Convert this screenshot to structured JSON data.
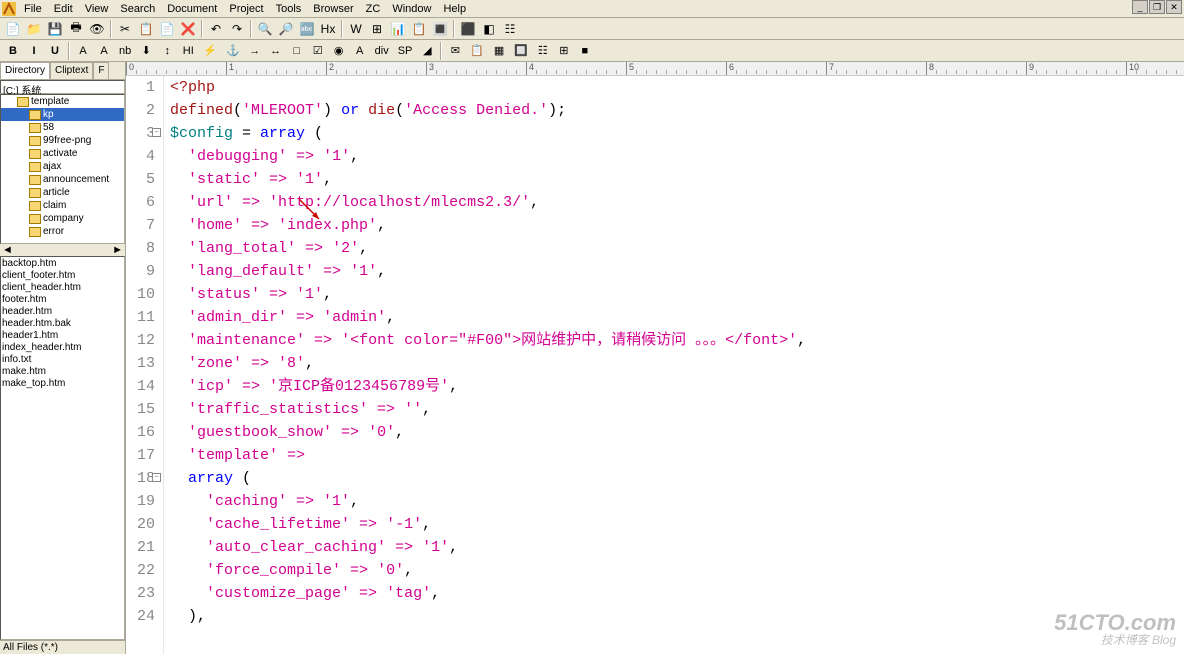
{
  "menu": [
    "File",
    "Edit",
    "View",
    "Search",
    "Document",
    "Project",
    "Tools",
    "Browser",
    "ZC",
    "Window",
    "Help"
  ],
  "winbtn": {
    "min": "_",
    "restore": "❐",
    "close": "✕"
  },
  "toolbar1": [
    "📄",
    "📁",
    "💾",
    "🖶",
    "👁",
    "|",
    "✂",
    "📋",
    "📄",
    "❌",
    "|",
    "↶",
    "↷",
    "|",
    "🔍",
    "🔎",
    "🔤",
    "Hx",
    "|",
    "W",
    "⊞",
    "📊",
    "📋",
    "🔳",
    "|",
    "⬛",
    "◧",
    "☷"
  ],
  "toolbar2_left": [
    "B",
    "I",
    "U"
  ],
  "toolbar2_mid": [
    "A",
    "A",
    "nb",
    "⬇",
    "↕",
    "HI",
    "⚡",
    "⚓",
    "→",
    "↔",
    "□",
    "☑",
    "◉",
    "A",
    "div",
    "SP",
    "◢"
  ],
  "toolbar2_right": [
    "✉",
    "📋",
    "▦",
    "🔲",
    "☷",
    "⊞",
    "■"
  ],
  "sidebar": {
    "tabs": [
      "Directory",
      "Cliptext",
      "F"
    ],
    "path": "[C:] 系统",
    "tree": [
      {
        "name": "template",
        "indent": 16
      },
      {
        "name": "kp",
        "indent": 28,
        "sel": true
      },
      {
        "name": "58",
        "indent": 28
      },
      {
        "name": "99free-png",
        "indent": 28
      },
      {
        "name": "activate",
        "indent": 28
      },
      {
        "name": "ajax",
        "indent": 28
      },
      {
        "name": "announcement",
        "indent": 28
      },
      {
        "name": "article",
        "indent": 28
      },
      {
        "name": "claim",
        "indent": 28
      },
      {
        "name": "company",
        "indent": 28
      },
      {
        "name": "error",
        "indent": 28
      }
    ],
    "files": [
      "backtop.htm",
      "client_footer.htm",
      "client_header.htm",
      "footer.htm",
      "header.htm",
      "header.htm.bak",
      "header1.htm",
      "index_header.htm",
      "info.txt",
      "make.htm",
      "make_top.htm"
    ],
    "bottom": "All Files (*.*)"
  },
  "code": [
    {
      "n": 1,
      "segs": [
        {
          "t": "<?php",
          "c": "k-red"
        }
      ]
    },
    {
      "n": 2,
      "segs": [
        {
          "t": "defined",
          "c": "k-red"
        },
        {
          "t": "(",
          "c": ""
        },
        {
          "t": "'MLEROOT'",
          "c": "k-str"
        },
        {
          "t": ") ",
          "c": ""
        },
        {
          "t": "or",
          "c": "k-blue"
        },
        {
          "t": " ",
          "c": ""
        },
        {
          "t": "die",
          "c": "k-red"
        },
        {
          "t": "(",
          "c": ""
        },
        {
          "t": "'Access Denied.'",
          "c": "k-str"
        },
        {
          "t": ");",
          "c": ""
        }
      ]
    },
    {
      "n": 3,
      "fold": true,
      "segs": [
        {
          "t": "$config",
          "c": "k-var"
        },
        {
          "t": " = ",
          "c": ""
        },
        {
          "t": "array",
          "c": "k-blue"
        },
        {
          "t": " (",
          "c": ""
        }
      ]
    },
    {
      "n": 4,
      "segs": [
        {
          "t": "  ",
          "c": ""
        },
        {
          "t": "'debugging'",
          "c": "k-str"
        },
        {
          "t": " => ",
          "c": "k-op"
        },
        {
          "t": "'1'",
          "c": "k-str"
        },
        {
          "t": ",",
          "c": ""
        }
      ]
    },
    {
      "n": 5,
      "segs": [
        {
          "t": "  ",
          "c": ""
        },
        {
          "t": "'static'",
          "c": "k-str"
        },
        {
          "t": " => ",
          "c": "k-op"
        },
        {
          "t": "'1'",
          "c": "k-str"
        },
        {
          "t": ",",
          "c": ""
        }
      ]
    },
    {
      "n": 6,
      "mark": true,
      "segs": [
        {
          "t": "  ",
          "c": ""
        },
        {
          "t": "'url'",
          "c": "k-str"
        },
        {
          "t": " => ",
          "c": "k-op"
        },
        {
          "t": "'http://localhost/mlecms2.3/'",
          "c": "k-str"
        },
        {
          "t": ",",
          "c": ""
        }
      ]
    },
    {
      "n": 7,
      "segs": [
        {
          "t": "  ",
          "c": ""
        },
        {
          "t": "'home'",
          "c": "k-str"
        },
        {
          "t": " => ",
          "c": "k-op"
        },
        {
          "t": "'index.php'",
          "c": "k-str"
        },
        {
          "t": ",",
          "c": ""
        }
      ]
    },
    {
      "n": 8,
      "segs": [
        {
          "t": "  ",
          "c": ""
        },
        {
          "t": "'lang_total'",
          "c": "k-str"
        },
        {
          "t": " => ",
          "c": "k-op"
        },
        {
          "t": "'2'",
          "c": "k-str"
        },
        {
          "t": ",",
          "c": ""
        }
      ]
    },
    {
      "n": 9,
      "segs": [
        {
          "t": "  ",
          "c": ""
        },
        {
          "t": "'lang_default'",
          "c": "k-str"
        },
        {
          "t": " => ",
          "c": "k-op"
        },
        {
          "t": "'1'",
          "c": "k-str"
        },
        {
          "t": ",",
          "c": ""
        }
      ]
    },
    {
      "n": 10,
      "segs": [
        {
          "t": "  ",
          "c": ""
        },
        {
          "t": "'status'",
          "c": "k-str"
        },
        {
          "t": " => ",
          "c": "k-op"
        },
        {
          "t": "'1'",
          "c": "k-str"
        },
        {
          "t": ",",
          "c": ""
        }
      ]
    },
    {
      "n": 11,
      "segs": [
        {
          "t": "  ",
          "c": ""
        },
        {
          "t": "'admin_dir'",
          "c": "k-str"
        },
        {
          "t": " => ",
          "c": "k-op"
        },
        {
          "t": "'admin'",
          "c": "k-str"
        },
        {
          "t": ",",
          "c": ""
        }
      ]
    },
    {
      "n": 12,
      "segs": [
        {
          "t": "  ",
          "c": ""
        },
        {
          "t": "'maintenance'",
          "c": "k-str"
        },
        {
          "t": " => ",
          "c": "k-op"
        },
        {
          "t": "'<font color=\"#F00\">网站维护中，请稍候访问 。。。</font>'",
          "c": "k-str"
        },
        {
          "t": ",",
          "c": ""
        }
      ]
    },
    {
      "n": 13,
      "segs": [
        {
          "t": "  ",
          "c": ""
        },
        {
          "t": "'zone'",
          "c": "k-str"
        },
        {
          "t": " => ",
          "c": "k-op"
        },
        {
          "t": "'8'",
          "c": "k-str"
        },
        {
          "t": ",",
          "c": ""
        }
      ]
    },
    {
      "n": 14,
      "segs": [
        {
          "t": "  ",
          "c": ""
        },
        {
          "t": "'icp'",
          "c": "k-str"
        },
        {
          "t": " => ",
          "c": "k-op"
        },
        {
          "t": "'京ICP备0123456789号'",
          "c": "k-str"
        },
        {
          "t": ",",
          "c": ""
        }
      ]
    },
    {
      "n": 15,
      "segs": [
        {
          "t": "  ",
          "c": ""
        },
        {
          "t": "'traffic_statistics'",
          "c": "k-str"
        },
        {
          "t": " => ",
          "c": "k-op"
        },
        {
          "t": "''",
          "c": "k-str"
        },
        {
          "t": ",",
          "c": ""
        }
      ]
    },
    {
      "n": 16,
      "segs": [
        {
          "t": "  ",
          "c": ""
        },
        {
          "t": "'guestbook_show'",
          "c": "k-str"
        },
        {
          "t": " => ",
          "c": "k-op"
        },
        {
          "t": "'0'",
          "c": "k-str"
        },
        {
          "t": ",",
          "c": ""
        }
      ]
    },
    {
      "n": 17,
      "segs": [
        {
          "t": "  ",
          "c": ""
        },
        {
          "t": "'template'",
          "c": "k-str"
        },
        {
          "t": " =>",
          "c": "k-op"
        }
      ]
    },
    {
      "n": 18,
      "fold": true,
      "segs": [
        {
          "t": "  ",
          "c": ""
        },
        {
          "t": "array",
          "c": "k-blue"
        },
        {
          "t": " (",
          "c": ""
        }
      ]
    },
    {
      "n": 19,
      "segs": [
        {
          "t": "    ",
          "c": ""
        },
        {
          "t": "'caching'",
          "c": "k-str"
        },
        {
          "t": " => ",
          "c": "k-op"
        },
        {
          "t": "'1'",
          "c": "k-str"
        },
        {
          "t": ",",
          "c": ""
        }
      ]
    },
    {
      "n": 20,
      "segs": [
        {
          "t": "    ",
          "c": ""
        },
        {
          "t": "'cache_lifetime'",
          "c": "k-str"
        },
        {
          "t": " => ",
          "c": "k-op"
        },
        {
          "t": "'-1'",
          "c": "k-str"
        },
        {
          "t": ",",
          "c": ""
        }
      ]
    },
    {
      "n": 21,
      "segs": [
        {
          "t": "    ",
          "c": ""
        },
        {
          "t": "'auto_clear_caching'",
          "c": "k-str"
        },
        {
          "t": " => ",
          "c": "k-op"
        },
        {
          "t": "'1'",
          "c": "k-str"
        },
        {
          "t": ",",
          "c": ""
        }
      ]
    },
    {
      "n": 22,
      "segs": [
        {
          "t": "    ",
          "c": ""
        },
        {
          "t": "'force_compile'",
          "c": "k-str"
        },
        {
          "t": " => ",
          "c": "k-op"
        },
        {
          "t": "'0'",
          "c": "k-str"
        },
        {
          "t": ",",
          "c": ""
        }
      ]
    },
    {
      "n": 23,
      "segs": [
        {
          "t": "    ",
          "c": ""
        },
        {
          "t": "'customize_page'",
          "c": "k-str"
        },
        {
          "t": " => ",
          "c": "k-op"
        },
        {
          "t": "'tag'",
          "c": "k-str"
        },
        {
          "t": ",",
          "c": ""
        }
      ]
    },
    {
      "n": 24,
      "segs": [
        {
          "t": "  ),",
          "c": ""
        }
      ]
    }
  ],
  "watermark": {
    "main": "51CTO.com",
    "sub": "技术博客  Blog"
  }
}
